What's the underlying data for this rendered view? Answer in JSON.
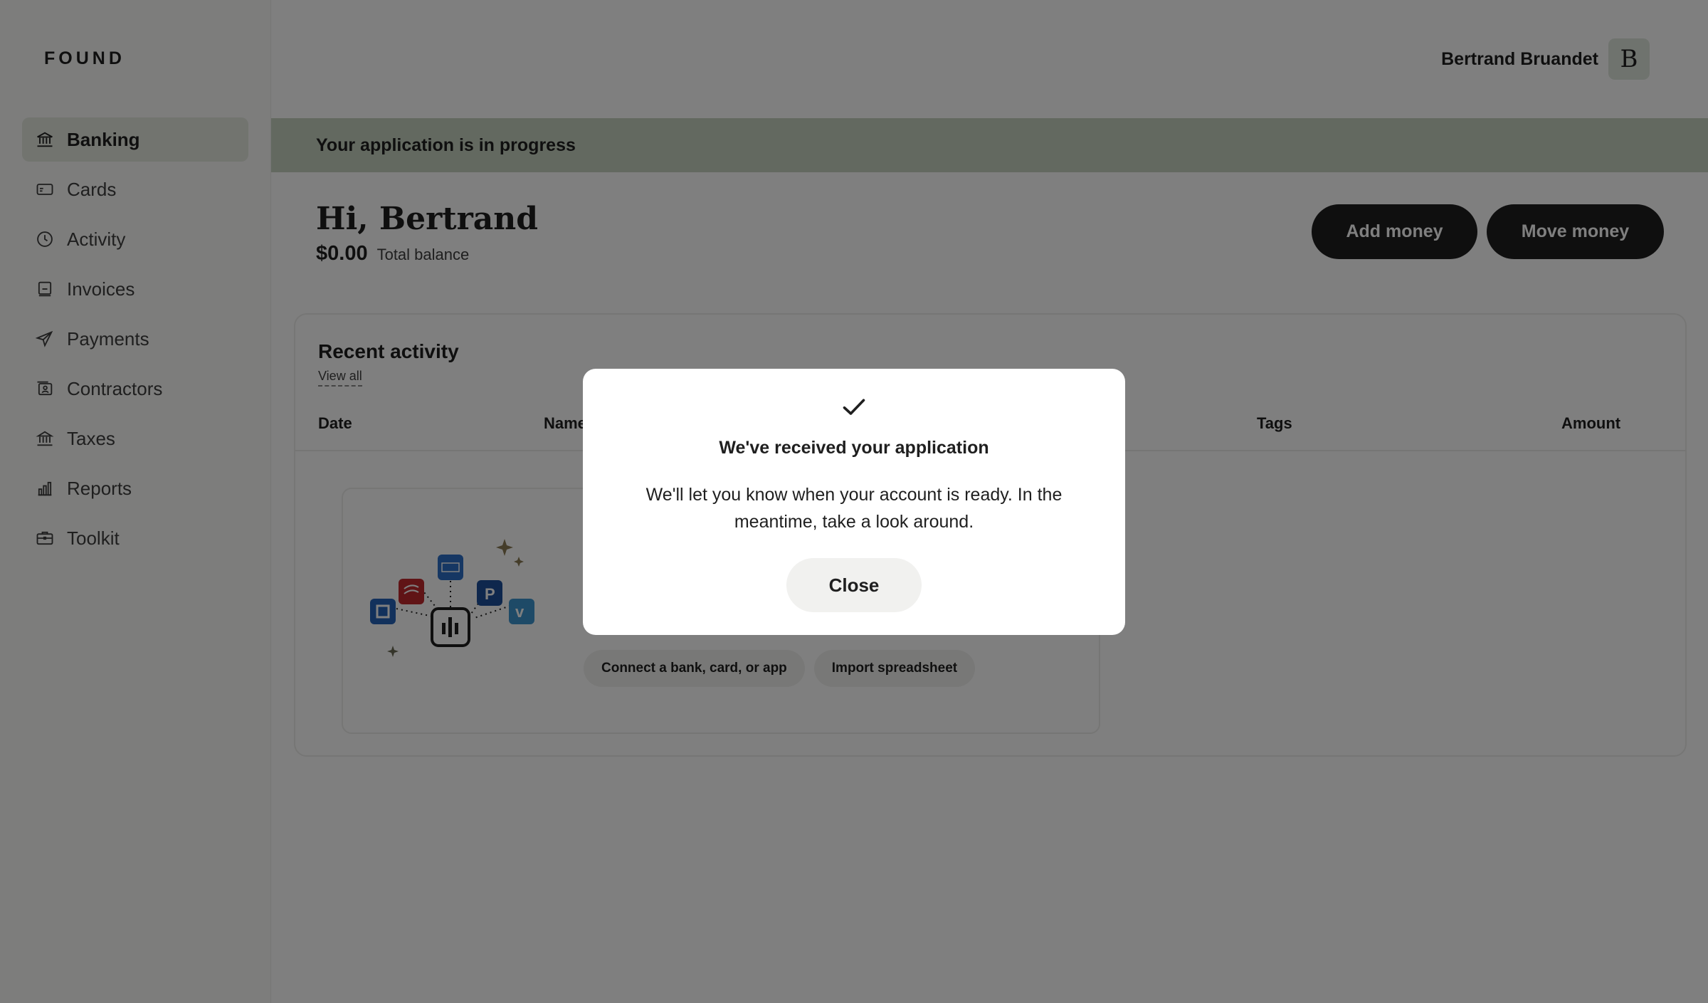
{
  "app": {
    "logo": "FOUND"
  },
  "sidebar": {
    "items": [
      {
        "label": "Banking",
        "icon": "bank-icon",
        "active": true
      },
      {
        "label": "Cards",
        "icon": "card-icon"
      },
      {
        "label": "Activity",
        "icon": "clock-icon"
      },
      {
        "label": "Invoices",
        "icon": "invoice-icon"
      },
      {
        "label": "Payments",
        "icon": "send-icon"
      },
      {
        "label": "Contractors",
        "icon": "contractor-icon"
      },
      {
        "label": "Taxes",
        "icon": "government-icon"
      },
      {
        "label": "Reports",
        "icon": "bar-chart-icon"
      },
      {
        "label": "Toolkit",
        "icon": "briefcase-icon"
      }
    ]
  },
  "user": {
    "name": "Bertrand Bruandet",
    "initial": "B"
  },
  "banner": {
    "text": "Your application is in progress"
  },
  "header": {
    "greeting": "Hi, Bertrand",
    "balance": "$0.00",
    "balance_label": "Total balance",
    "add_money": "Add money",
    "move_money": "Move money"
  },
  "activity": {
    "title": "Recent activity",
    "view_all": "View all",
    "columns": [
      "Date",
      "Name",
      "Tags",
      "Amount"
    ],
    "empty_actions": [
      "Connect a bank, card, or app",
      "Import spreadsheet"
    ]
  },
  "modal": {
    "icon": "checkmark-icon",
    "title": "We've received your application",
    "body": "We'll let you know when your account is ready. In the meantime, take a look around.",
    "close": "Close"
  },
  "colors": {
    "active_nav": "#e4e9df",
    "banner": "#c6d2c1",
    "primary_button": "#1f1f1f",
    "overlay": "rgba(0,0,0,0.5)"
  }
}
